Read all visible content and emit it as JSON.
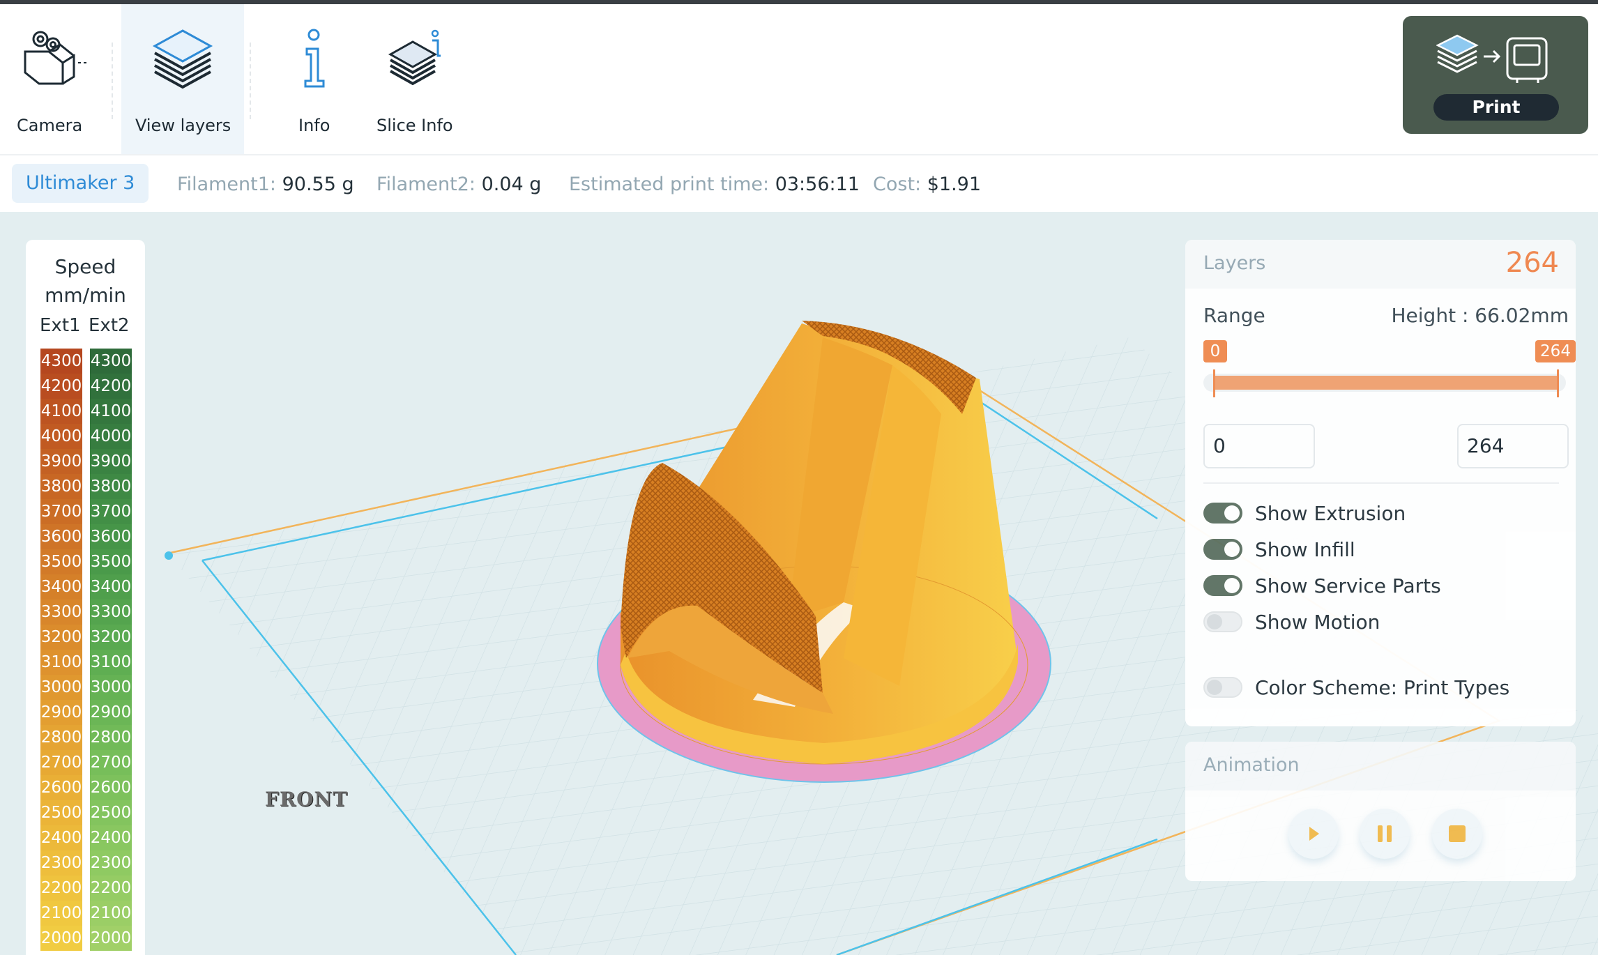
{
  "toolbar": {
    "tools": [
      {
        "label": "Camera",
        "icon": "camera-icon"
      },
      {
        "label": "View layers",
        "icon": "layers-icon"
      },
      {
        "label": "Info",
        "icon": "info-icon"
      },
      {
        "label": "Slice Info",
        "icon": "slice-info-icon"
      }
    ],
    "print_label": "Print"
  },
  "infobar": {
    "printer": "Ultimaker 3",
    "filament1_key": "Filament1:",
    "filament1_val": "90.55 g",
    "filament2_key": "Filament2:",
    "filament2_val": "0.04 g",
    "time_key": "Estimated print time:",
    "time_val": "03:56:11",
    "cost_key": "Cost:",
    "cost_val": "$1.91"
  },
  "legend": {
    "title_line1": "Speed",
    "title_line2": "mm/min",
    "ext1": "Ext1",
    "ext2": "Ext2",
    "values": [
      "4300",
      "4200",
      "4100",
      "4000",
      "3900",
      "3800",
      "3700",
      "3600",
      "3500",
      "3400",
      "3300",
      "3200",
      "3100",
      "3000",
      "2900",
      "2800",
      "2700",
      "2600",
      "2500",
      "2400",
      "2300",
      "2200",
      "2100",
      "2000"
    ],
    "ext1_colors": [
      "#b5471f",
      "#b94d20",
      "#bd5421",
      "#c15a22",
      "#c46123",
      "#c86724",
      "#cb6d25",
      "#cf7427",
      "#d27a28",
      "#d58029",
      "#d8862b",
      "#db8c2c",
      "#de922e",
      "#e0982f",
      "#e39e31",
      "#e5a433",
      "#e7a934",
      "#e9af36",
      "#ebb438",
      "#ecb93a",
      "#eebe3c",
      "#efc33e",
      "#f0c840",
      "#f1cc42"
    ],
    "ext2_colors": [
      "#2e6b3a",
      "#31713c",
      "#34773e",
      "#377d40",
      "#3a8342",
      "#3e8944",
      "#428f46",
      "#469548",
      "#4a9a4a",
      "#4f9f4c",
      "#54a44e",
      "#59a950",
      "#5fae52",
      "#65b254",
      "#6bb656",
      "#71ba58",
      "#77be5a",
      "#7dc15c",
      "#83c45e",
      "#89c760",
      "#8fca62",
      "#95cc64",
      "#9bce66",
      "#a1d068"
    ]
  },
  "scene": {
    "front_label": "FRONT"
  },
  "layers_panel": {
    "title": "Layers",
    "count": "264",
    "range_label": "Range",
    "height_label": "Height : 66.02mm",
    "min_handle": "0",
    "max_handle": "264",
    "min_value": "0",
    "max_value": "264",
    "toggles": [
      {
        "label": "Show Extrusion",
        "on": true
      },
      {
        "label": "Show Infill",
        "on": true
      },
      {
        "label": "Show Service Parts",
        "on": true
      },
      {
        "label": "Show Motion",
        "on": false
      },
      {
        "label": "Color Scheme: Print Types",
        "on": false
      }
    ]
  },
  "animation_panel": {
    "title": "Animation",
    "buttons": [
      "play-icon",
      "pause-icon",
      "stop-icon"
    ]
  },
  "colors": {
    "accent_orange": "#f08a4e",
    "printer_blue": "#2e8bd6",
    "model_yellow": "#f2a92e",
    "brim_pink": "#e79ac8",
    "toggle_on": "#5d7263"
  }
}
